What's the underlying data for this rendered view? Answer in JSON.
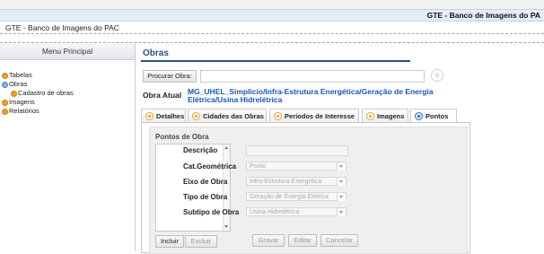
{
  "app": {
    "title": "GTE - Banco de Imagens do PA",
    "subtitle": "GTE - Banco de Imagens do PAC"
  },
  "sidebar": {
    "header": "Menu Principal",
    "items": [
      {
        "label": "Tabelas"
      },
      {
        "label": "Obras"
      },
      {
        "label": "Cadastro de obras"
      },
      {
        "label": "Imagens"
      },
      {
        "label": "Relatórios"
      }
    ]
  },
  "main": {
    "title": "Obras",
    "search_button": "Procurar Obra:",
    "search_value": "",
    "obra_label": "Obra Atual",
    "obra_value": "MG_UHEL_Simplicio/Infra-Estrutura Energética/Geração de Energia Elétrica/Usina Hidrelétrica",
    "tabs": [
      {
        "label": "Detalhes"
      },
      {
        "label": "Cidades das Obras"
      },
      {
        "label": "Períodos de Interesse"
      },
      {
        "label": "Imagens"
      },
      {
        "label": "Pontos"
      }
    ],
    "pontos": {
      "title": "Pontos de Obra",
      "fields": {
        "descricao": {
          "label": "Descrição",
          "value": ""
        },
        "cat_geometrica": {
          "label": "Cat.Geométrica",
          "value": "Ponto"
        },
        "eixo": {
          "label": "Eixo de Obra",
          "value": "Infra-Estrutura Energética"
        },
        "tipo": {
          "label": "Tipo de Obra",
          "value": "Geração de Energia Elétrica"
        },
        "subtipo": {
          "label": "Subtipo de Obra",
          "value": "Usina Hidrelétrica"
        }
      },
      "buttons": {
        "incluir": "Incluir",
        "excluir": "Excluir",
        "gravar": "Gravar",
        "editar": "Editar",
        "cancelar": "Cancelar"
      }
    }
  }
}
